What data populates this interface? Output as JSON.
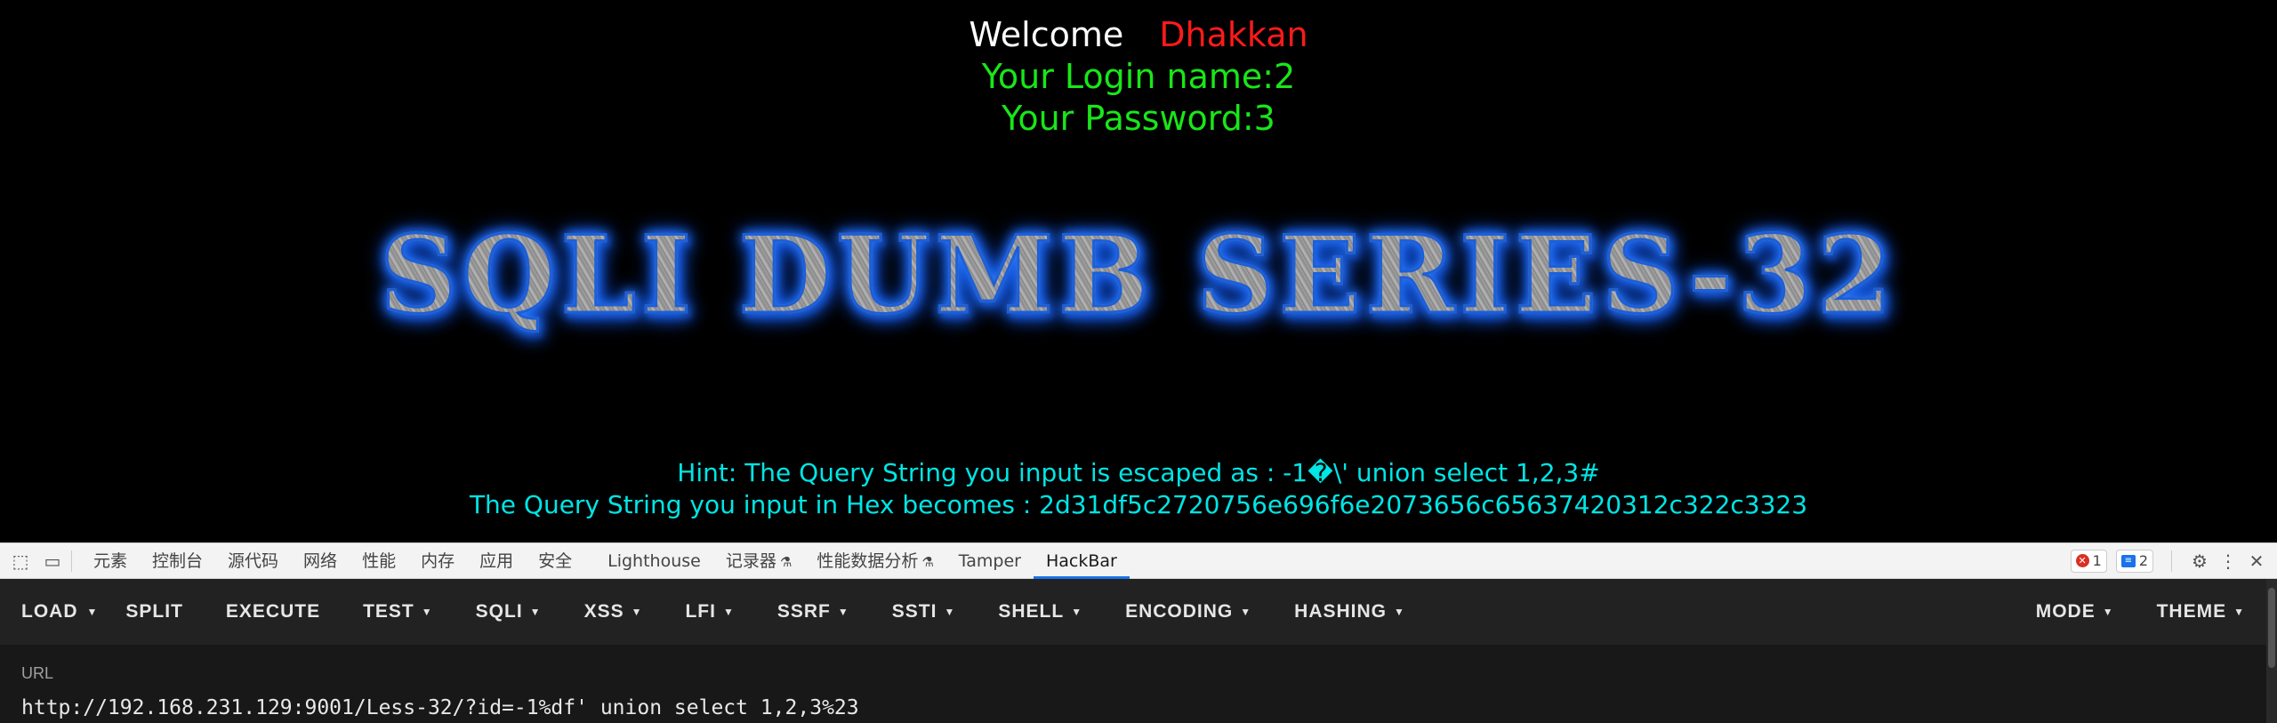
{
  "page": {
    "welcome_word": "Welcome",
    "welcome_name": "Dhakkan",
    "login_name": "Your Login name:2",
    "password": "Your Password:3",
    "banner": "SQLI DUMB SERIES-32",
    "hint_line1": "Hint: The Query String you input is escaped as : -1�\\' union select 1,2,3#",
    "hint_line2": "The Query String you input in Hex becomes : 2d31df5c2720756e696f6e2073656c65637420312c322c3323"
  },
  "devtools": {
    "tabs": [
      "元素",
      "控制台",
      "源代码",
      "网络",
      "性能",
      "内存",
      "应用",
      "安全",
      "Lighthouse",
      "记录器",
      "性能数据分析",
      "Tamper",
      "HackBar"
    ],
    "active_tab": "HackBar",
    "error_count": "1",
    "message_count": "2"
  },
  "hackbar": {
    "buttons": [
      "LOAD",
      "SPLIT",
      "EXECUTE",
      "TEST",
      "SQLI",
      "XSS",
      "LFI",
      "SSRF",
      "SSTI",
      "SHELL",
      "ENCODING",
      "HASHING"
    ],
    "right_buttons": [
      "MODE",
      "THEME"
    ],
    "url_label": "URL",
    "url_value": "http://192.168.231.129:9001/Less-32/?id=-1%df' union select 1,2,3%23"
  },
  "colors": {
    "welcome_name": "#ff1a1a",
    "login_text": "#19e619",
    "hint_text": "#00e5e5",
    "banner_glow": "#2b7bff"
  }
}
